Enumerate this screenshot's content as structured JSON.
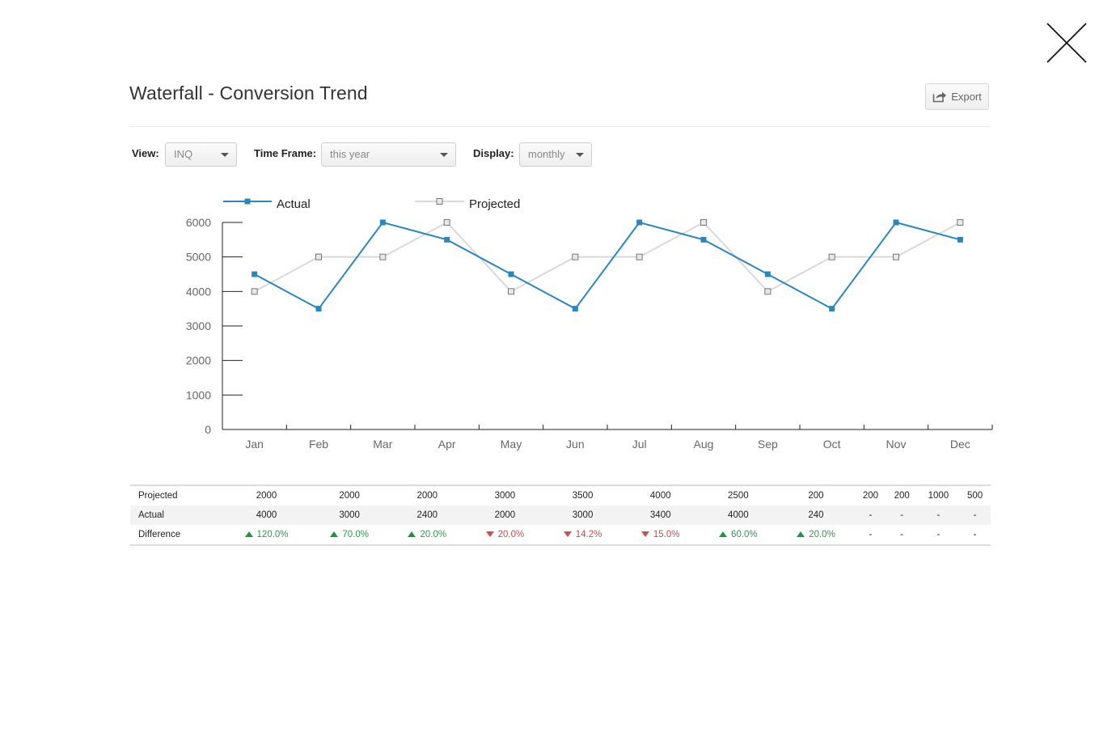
{
  "modal": {
    "title": "Waterfall - Conversion Trend",
    "close_icon": "close-icon"
  },
  "toolbar": {
    "export_label": "Export",
    "export_icon": "share-arrow-icon"
  },
  "filters": {
    "view": {
      "label": "View:",
      "value": "INQ"
    },
    "timeframe": {
      "label": "Time Frame:",
      "value": "this year"
    },
    "display": {
      "label": "Display:",
      "value": "monthly"
    }
  },
  "colors": {
    "actual": "#2a86bf",
    "projected": "#d9d9d9",
    "up": "#1f9447",
    "down": "#c9524e"
  },
  "chart_data": {
    "type": "line",
    "categories": [
      "Jan",
      "Feb",
      "Mar",
      "Apr",
      "May",
      "Jun",
      "Jul",
      "Aug",
      "Sep",
      "Oct",
      "Nov",
      "Dec"
    ],
    "series": [
      {
        "name": "Actual",
        "values": [
          4500,
          3500,
          6000,
          5500,
          4500,
          3500,
          6000,
          5500,
          4500,
          3500,
          6000,
          5500
        ]
      },
      {
        "name": "Projected",
        "values": [
          4000,
          5000,
          5000,
          6000,
          4000,
          5000,
          5000,
          6000,
          4000,
          5000,
          5000,
          6000
        ]
      }
    ],
    "ylim": [
      0,
      6000
    ],
    "yticks": [
      0,
      1000,
      2000,
      3000,
      4000,
      5000,
      6000
    ],
    "legend": "top-left",
    "grid": false
  },
  "table": {
    "rows": [
      {
        "label": "Projected",
        "cells": [
          "2000",
          "2000",
          "2000",
          "3000",
          "3500",
          "4000",
          "2500",
          "200",
          "200",
          "200",
          "1000",
          "500"
        ]
      },
      {
        "label": "Actual",
        "cells": [
          "4000",
          "3000",
          "2400",
          "2000",
          "3000",
          "3400",
          "4000",
          "240",
          "-",
          "-",
          "-",
          "-"
        ]
      },
      {
        "label": "Difference",
        "cells": [
          {
            "dir": "up",
            "value": "120.0%"
          },
          {
            "dir": "up",
            "value": "70.0%"
          },
          {
            "dir": "up",
            "value": "20.0%"
          },
          {
            "dir": "down",
            "value": "20.0%"
          },
          {
            "dir": "down",
            "value": "14.2%"
          },
          {
            "dir": "down",
            "value": "15.0%"
          },
          {
            "dir": "up",
            "value": "60.0%"
          },
          {
            "dir": "up",
            "value": "20.0%"
          },
          {
            "dir": "",
            "value": "-"
          },
          {
            "dir": "",
            "value": "-"
          },
          {
            "dir": "",
            "value": "-"
          },
          {
            "dir": "",
            "value": "-"
          }
        ]
      }
    ]
  }
}
